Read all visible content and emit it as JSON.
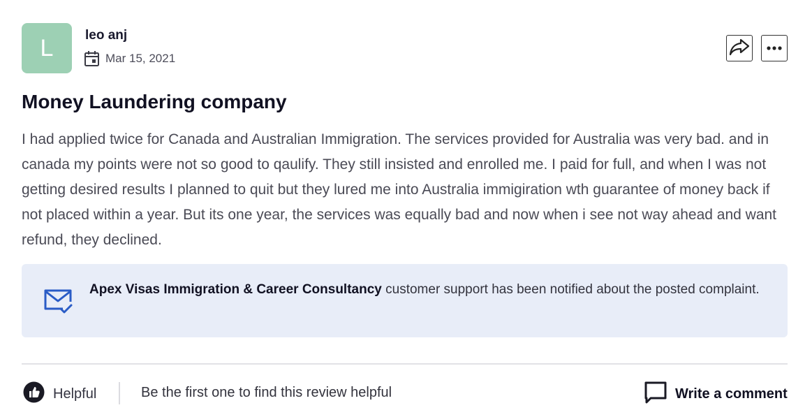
{
  "author": {
    "initial": "L",
    "name": "leo anj",
    "date": "Mar 15, 2021",
    "avatar_color": "#9dd0b4"
  },
  "icons": {
    "date": "calendar-icon",
    "share": "share-icon",
    "more": "more-icon",
    "notice": "mail-check-icon",
    "helpful": "thumbs-up-icon",
    "comment": "comment-icon"
  },
  "review": {
    "title": "Money Laundering company",
    "body": "I had applied twice for Canada and Australian Immigration. The services provided for Australia was very bad. and in canada my points were not so good to qaulify. They still insisted and enrolled me. I paid for full, and when I was not getting desired results I planned to quit but they lured me into Australia immigiration wth guarantee of money back if not placed within a year. But its one year, the services was equally bad and now when i see not way ahead and want refund, they declined."
  },
  "notice": {
    "company": "Apex Visas Immigration & Career Consultancy",
    "message": " customer support has been notified about the posted complaint.",
    "background": "#e8edf8",
    "icon_color": "#2a5cc6"
  },
  "footer": {
    "helpful_label": "Helpful",
    "helpful_hint": "Be the first one to find this review helpful",
    "comment_label": "Write a comment"
  }
}
